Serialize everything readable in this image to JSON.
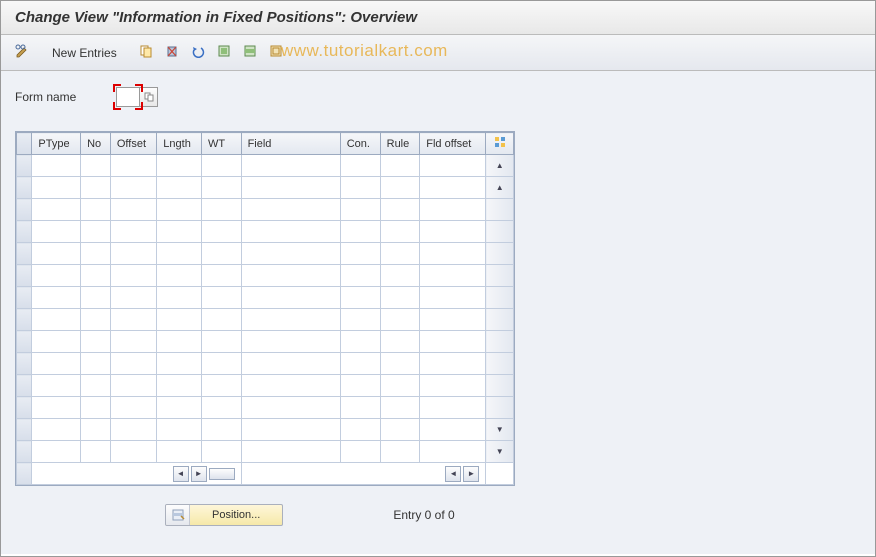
{
  "header": {
    "title": "Change View \"Information in Fixed Positions\": Overview"
  },
  "toolbar": {
    "new_entries": "New Entries"
  },
  "watermark": "www.tutorialkart.com",
  "form": {
    "name_label": "Form name",
    "name_value": ""
  },
  "table": {
    "columns": [
      "PType",
      "No",
      "Offset",
      "Lngth",
      "WT",
      "Field",
      "Con.",
      "Rule",
      "Fld offset"
    ],
    "num_empty_rows": 14
  },
  "footer": {
    "position_label": "Position...",
    "entry_text": "Entry 0 of 0"
  }
}
